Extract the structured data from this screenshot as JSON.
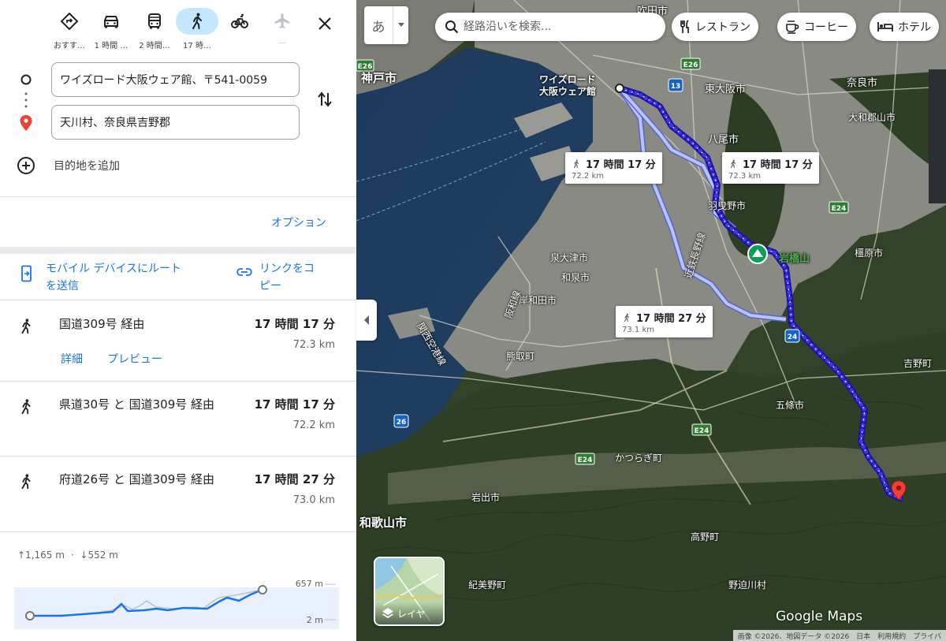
{
  "travel_modes": [
    {
      "name": "best",
      "label": "おすす…",
      "active": false
    },
    {
      "name": "drive",
      "label": "1 時間 …",
      "active": false
    },
    {
      "name": "transit",
      "label": "2 時間…",
      "active": false
    },
    {
      "name": "walk",
      "label": "17 時…",
      "active": true
    },
    {
      "name": "bicycle",
      "label": "",
      "active": false
    },
    {
      "name": "flight",
      "label": "—",
      "active": false
    }
  ],
  "origin": {
    "value": "ワイズロード大阪ウェア館、〒541-0059"
  },
  "destination": {
    "value": "天川村、奈良県吉野郡"
  },
  "add_destination": "目的地を追加",
  "options_label": "オプション",
  "share": {
    "send_to_device": "モバイル デバイスにルートを送信",
    "send_line1": "モバイル デバイスにルート",
    "send_line2": "を送信",
    "copy_link_line1": "リンクをコ",
    "copy_link_line2": "ピー"
  },
  "routes": [
    {
      "name": "国道309号 経由",
      "time": "17 時間 17 分",
      "distance": "72.3 km",
      "details": "詳細",
      "preview": "プレビュー"
    },
    {
      "name": "県道30号 と 国道309号 経由",
      "time": "17 時間 17 分",
      "distance": "72.2 km"
    },
    {
      "name": "府道26号 と 国道309号 経由",
      "time": "17 時間 27 分",
      "distance": "73.0 km"
    }
  ],
  "elevation": {
    "ascent": "↑1,165 m",
    "descent": "↓552 m",
    "separator": "·",
    "max_label": "657 m",
    "min_label": "2 m"
  },
  "map": {
    "ime_char": "あ",
    "search_placeholder": "経路沿いを検索...",
    "chips": [
      "レストラン",
      "コーヒー",
      "ホテル"
    ],
    "callouts": [
      {
        "time": "17 時間 17 分",
        "distance": "72.2 km"
      },
      {
        "time": "17 時間 17 分",
        "distance": "72.3 km"
      },
      {
        "time": "17 時間 27 分",
        "distance": "73.1 km"
      }
    ],
    "origin_label_line1": "ワイズロード",
    "origin_label_line2": "大阪ウェア館",
    "landmark": "岩橋山",
    "cities": {
      "kobe": "神戸市",
      "higashiosaka": "東大阪市",
      "yao": "八尾市",
      "habikino": "羽曳野市",
      "nara": "奈良市",
      "yamatokoriyama": "大和郡山市",
      "izumiotsu": "泉大津市",
      "izumi": "和泉市",
      "kishiwada": "岸和田市",
      "kumatori": "熊取町",
      "kashihara": "橿原市",
      "yoshino": "吉野町",
      "gojo": "五條市",
      "katsuragi": "かつらぎ町",
      "iwade": "岩出市",
      "wakayama": "和歌山市",
      "koya": "高野町",
      "kimino": "紀美野町",
      "nosegawa": "野迫川村",
      "suita": "吹田市"
    },
    "highways": {
      "kansai_airport": "関西空港線",
      "hanwa": "阪和線",
      "kintetsu": "近鉄長野線"
    },
    "route_shields": [
      "E26",
      "13",
      "E24",
      "24",
      "26",
      "E24",
      "E24",
      "E26"
    ],
    "layer_label": "レイヤ",
    "logo": "Google Maps",
    "attribution": "画像 ©2026、地図データ ©2026　日本　利用規約　プライバ"
  },
  "colors": {
    "accent": "#1a73e8",
    "active_mode": "#c2e7ff",
    "primary_route": "#3b2fd1",
    "alt_route": "#a9b8ff",
    "destination_pin": "#ea4335"
  }
}
